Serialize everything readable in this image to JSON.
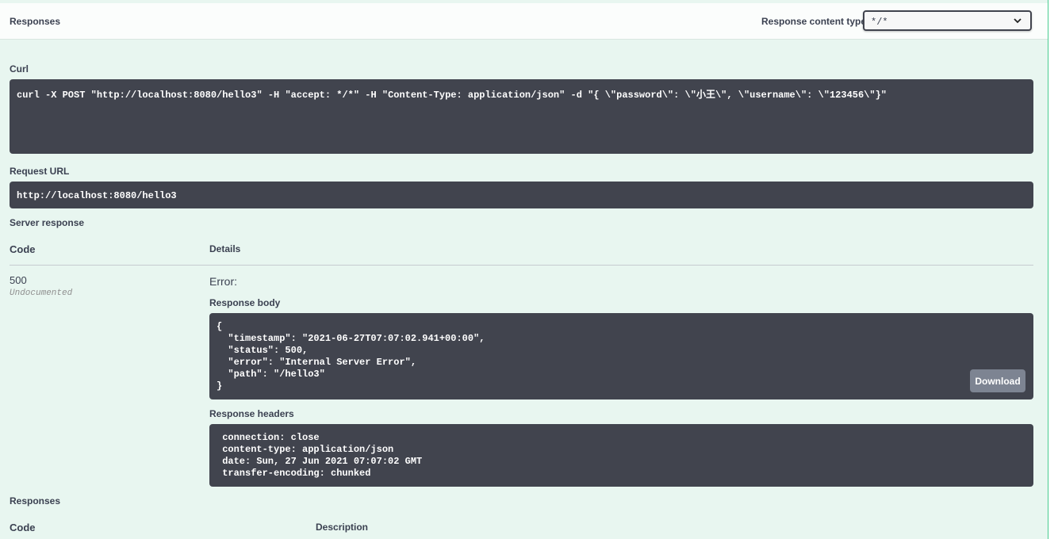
{
  "responses_header": {
    "title": "Responses",
    "content_type_label": "Response content type",
    "content_type_value": "*/*"
  },
  "curl": {
    "label": "Curl",
    "command": "curl -X POST \"http://localhost:8080/hello3\" -H \"accept: */*\" -H \"Content-Type: application/json\" -d \"{ \\\"password\\\": \\\"小王\\\", \\\"username\\\": \\\"123456\\\"}\""
  },
  "request_url": {
    "label": "Request URL",
    "value": "http://localhost:8080/hello3"
  },
  "server_response": {
    "label": "Server response",
    "code_header": "Code",
    "details_header": "Details",
    "code": "500",
    "code_note": "Undocumented",
    "error_label": "Error:",
    "body_label": "Response body",
    "body": "{\n  \"timestamp\": \"2021-06-27T07:07:02.941+00:00\",\n  \"status\": 500,\n  \"error\": \"Internal Server Error\",\n  \"path\": \"/hello3\"\n}",
    "download_label": "Download",
    "headers_label": "Response headers",
    "headers": " connection: close\n content-type: application/json\n date: Sun, 27 Jun 2021 07:07:02 GMT\n transfer-encoding: chunked"
  },
  "responses_footer": {
    "title": "Responses",
    "code_header": "Code",
    "description_header": "Description"
  },
  "colors": {
    "panel_bg": "#e8f6f0",
    "panel_border": "#49cc90",
    "code_block_bg": "#41444e",
    "download_bg": "#7d8492",
    "text": "#3b4151"
  },
  "icons": {
    "select_arrow": "chevron-down-icon"
  }
}
